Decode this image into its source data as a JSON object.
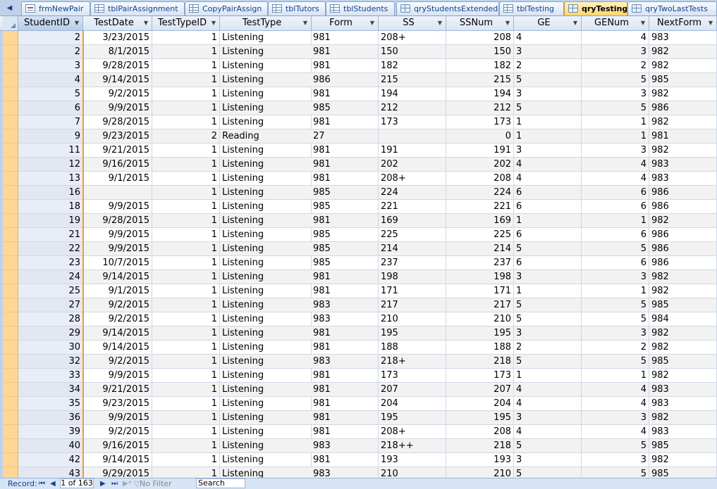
{
  "tabs": [
    {
      "label": "frmNewPair",
      "icon": "form-icon",
      "active": false
    },
    {
      "label": "tblPairAssignment",
      "icon": "table-icon",
      "active": false
    },
    {
      "label": "CopyPairAssign",
      "icon": "table-icon",
      "active": false
    },
    {
      "label": "tblTutors",
      "icon": "table-icon",
      "active": false
    },
    {
      "label": "tblStudents",
      "icon": "table-icon",
      "active": false
    },
    {
      "label": "qryStudentsExtended",
      "icon": "query-icon",
      "active": false
    },
    {
      "label": "tblTesting",
      "icon": "table-icon",
      "active": false
    },
    {
      "label": "qryTesting",
      "icon": "query-icon",
      "active": true
    },
    {
      "label": "qryTwoLastTests",
      "icon": "query-icon",
      "active": false
    }
  ],
  "columns": [
    "StudentID",
    "TestDate",
    "TestTypeID",
    "TestType",
    "Form",
    "SS",
    "SSNum",
    "GE",
    "GENum",
    "NextForm"
  ],
  "rows": [
    [
      "2",
      "3/23/2015",
      "1",
      "Listening",
      "981",
      "208+",
      "208",
      "4",
      "4",
      "983"
    ],
    [
      "2",
      "8/1/2015",
      "1",
      "Listening",
      "981",
      "150",
      "150",
      "3",
      "3",
      "982"
    ],
    [
      "3",
      "9/28/2015",
      "1",
      "Listening",
      "981",
      "182",
      "182",
      "2",
      "2",
      "982"
    ],
    [
      "4",
      "9/14/2015",
      "1",
      "Listening",
      "986",
      "215",
      "215",
      "5",
      "5",
      "985"
    ],
    [
      "5",
      "9/2/2015",
      "1",
      "Listening",
      "981",
      "194",
      "194",
      "3",
      "3",
      "982"
    ],
    [
      "6",
      "9/9/2015",
      "1",
      "Listening",
      "985",
      "212",
      "212",
      "5",
      "5",
      "986"
    ],
    [
      "7",
      "9/28/2015",
      "1",
      "Listening",
      "981",
      "173",
      "173",
      "1",
      "1",
      "982"
    ],
    [
      "9",
      "9/23/2015",
      "2",
      "Reading",
      "27",
      "",
      "0",
      "1",
      "1",
      "981"
    ],
    [
      "11",
      "9/21/2015",
      "1",
      "Listening",
      "981",
      "191",
      "191",
      "3",
      "3",
      "982"
    ],
    [
      "12",
      "9/16/2015",
      "1",
      "Listening",
      "981",
      "202",
      "202",
      "4",
      "4",
      "983"
    ],
    [
      "13",
      "9/1/2015",
      "1",
      "Listening",
      "981",
      "208+",
      "208",
      "4",
      "4",
      "983"
    ],
    [
      "16",
      "",
      "1",
      "Listening",
      "985",
      "224",
      "224",
      "6",
      "6",
      "986"
    ],
    [
      "18",
      "9/9/2015",
      "1",
      "Listening",
      "985",
      "221",
      "221",
      "6",
      "6",
      "986"
    ],
    [
      "19",
      "9/28/2015",
      "1",
      "Listening",
      "981",
      "169",
      "169",
      "1",
      "1",
      "982"
    ],
    [
      "21",
      "9/9/2015",
      "1",
      "Listening",
      "985",
      "225",
      "225",
      "6",
      "6",
      "986"
    ],
    [
      "22",
      "9/9/2015",
      "1",
      "Listening",
      "985",
      "214",
      "214",
      "5",
      "5",
      "986"
    ],
    [
      "23",
      "10/7/2015",
      "1",
      "Listening",
      "985",
      "237",
      "237",
      "6",
      "6",
      "986"
    ],
    [
      "24",
      "9/14/2015",
      "1",
      "Listening",
      "981",
      "198",
      "198",
      "3",
      "3",
      "982"
    ],
    [
      "25",
      "9/1/2015",
      "1",
      "Listening",
      "981",
      "171",
      "171",
      "1",
      "1",
      "982"
    ],
    [
      "27",
      "9/2/2015",
      "1",
      "Listening",
      "983",
      "217",
      "217",
      "5",
      "5",
      "985"
    ],
    [
      "28",
      "9/2/2015",
      "1",
      "Listening",
      "983",
      "210",
      "210",
      "5",
      "5",
      "984"
    ],
    [
      "29",
      "9/14/2015",
      "1",
      "Listening",
      "981",
      "195",
      "195",
      "3",
      "3",
      "982"
    ],
    [
      "30",
      "9/14/2015",
      "1",
      "Listening",
      "981",
      "188",
      "188",
      "2",
      "2",
      "982"
    ],
    [
      "32",
      "9/2/2015",
      "1",
      "Listening",
      "983",
      "218+",
      "218",
      "5",
      "5",
      "985"
    ],
    [
      "33",
      "9/9/2015",
      "1",
      "Listening",
      "981",
      "173",
      "173",
      "1",
      "1",
      "982"
    ],
    [
      "34",
      "9/21/2015",
      "1",
      "Listening",
      "981",
      "207",
      "207",
      "4",
      "4",
      "983"
    ],
    [
      "35",
      "9/23/2015",
      "1",
      "Listening",
      "981",
      "204",
      "204",
      "4",
      "4",
      "983"
    ],
    [
      "36",
      "9/9/2015",
      "1",
      "Listening",
      "981",
      "195",
      "195",
      "3",
      "3",
      "982"
    ],
    [
      "39",
      "9/2/2015",
      "1",
      "Listening",
      "981",
      "208+",
      "208",
      "4",
      "4",
      "983"
    ],
    [
      "40",
      "9/16/2015",
      "1",
      "Listening",
      "983",
      "218++",
      "218",
      "5",
      "5",
      "985"
    ],
    [
      "42",
      "9/14/2015",
      "1",
      "Listening",
      "981",
      "193",
      "193",
      "3",
      "3",
      "982"
    ],
    [
      "43",
      "9/29/2015",
      "1",
      "Listening",
      "983",
      "210",
      "210",
      "5",
      "5",
      "985"
    ]
  ],
  "status": {
    "record_label": "Record:",
    "record_position": "1 of 163",
    "filter_label": "No Filter",
    "search_placeholder": "Search"
  },
  "colors": {
    "selector": "#fdd795",
    "active_tab": "#ffd46e",
    "focus_line": "#f39c34"
  }
}
